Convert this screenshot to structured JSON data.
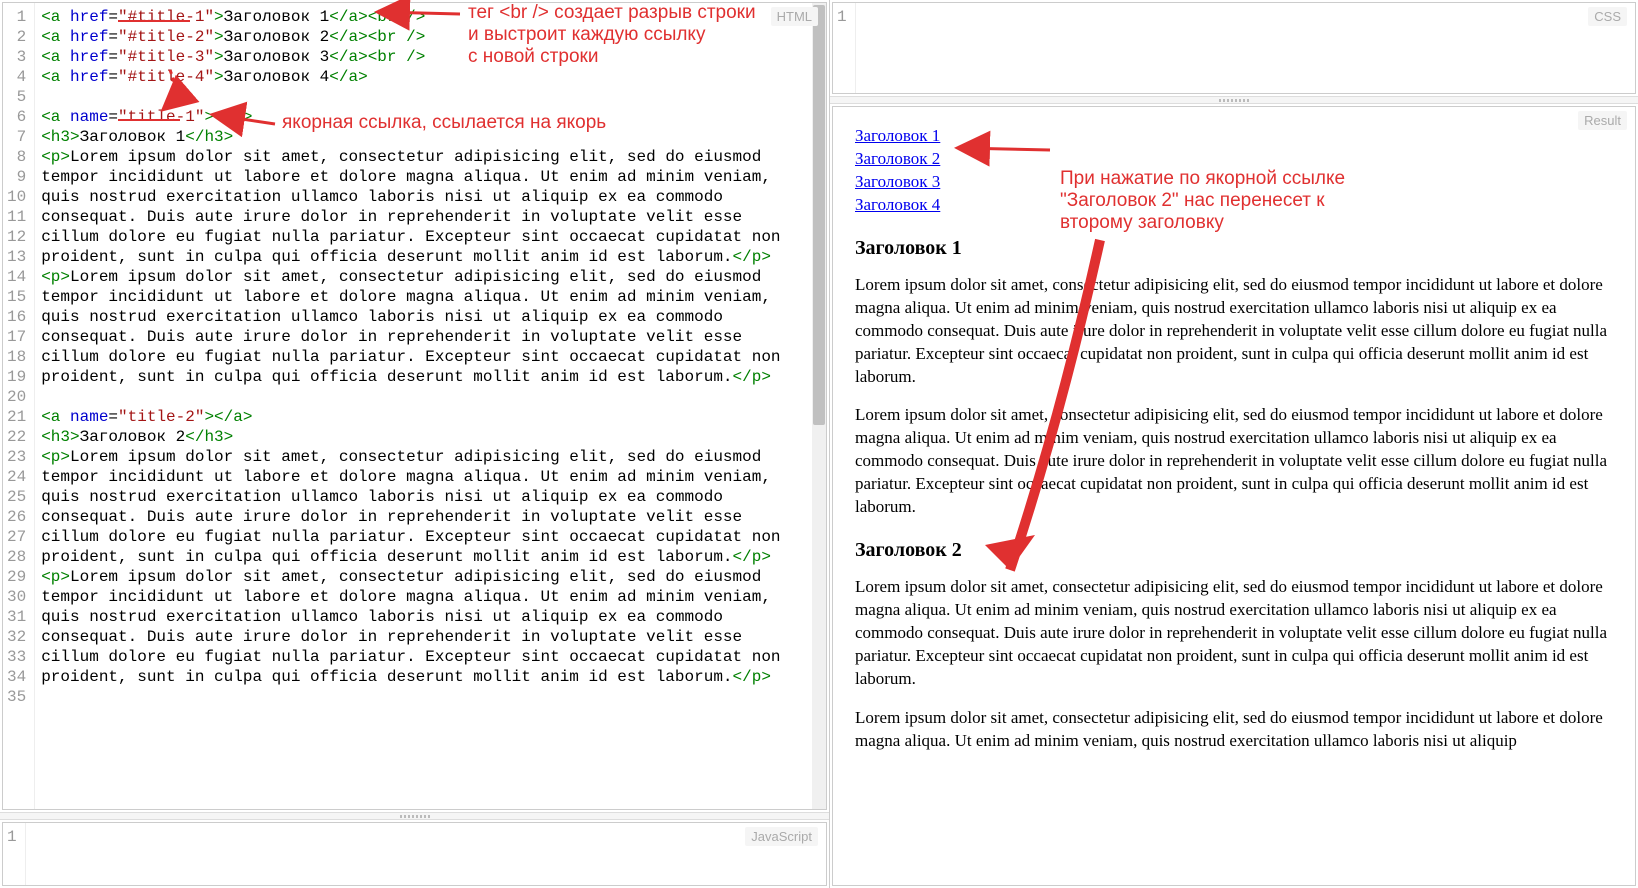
{
  "panels": {
    "html_label": "HTML",
    "css_label": "CSS",
    "js_label": "JavaScript",
    "result_label": "Result"
  },
  "css_panel": {
    "line_numbers": [
      "1"
    ]
  },
  "js_panel": {
    "line_numbers": [
      "1"
    ]
  },
  "html_code": {
    "line_numbers": [
      "1",
      "2",
      "3",
      "4",
      "5",
      "6",
      "7",
      "8",
      "9",
      "10",
      "11",
      "12",
      "13",
      "14",
      "15",
      "16",
      "17",
      "18",
      "19",
      "20",
      "21",
      "22",
      "23",
      "24",
      "25",
      "26",
      "27",
      "28",
      "29",
      "30",
      "31",
      "32",
      "33",
      "34",
      "35"
    ],
    "lines": [
      [
        {
          "c": "tag",
          "t": "<a"
        },
        {
          "c": "txt",
          "t": " "
        },
        {
          "c": "attr",
          "t": "href"
        },
        {
          "c": "txt",
          "t": "="
        },
        {
          "c": "val",
          "t": "\"#title-1\""
        },
        {
          "c": "tag",
          "t": ">"
        },
        {
          "c": "txt",
          "t": "Заголовок 1"
        },
        {
          "c": "tag",
          "t": "</a><br />"
        }
      ],
      [
        {
          "c": "tag",
          "t": "<a"
        },
        {
          "c": "txt",
          "t": " "
        },
        {
          "c": "attr",
          "t": "href"
        },
        {
          "c": "txt",
          "t": "="
        },
        {
          "c": "val",
          "t": "\"#title-2\""
        },
        {
          "c": "tag",
          "t": ">"
        },
        {
          "c": "txt",
          "t": "Заголовок 2"
        },
        {
          "c": "tag",
          "t": "</a><br />"
        }
      ],
      [
        {
          "c": "tag",
          "t": "<a"
        },
        {
          "c": "txt",
          "t": " "
        },
        {
          "c": "attr",
          "t": "href"
        },
        {
          "c": "txt",
          "t": "="
        },
        {
          "c": "val",
          "t": "\"#title-3\""
        },
        {
          "c": "tag",
          "t": ">"
        },
        {
          "c": "txt",
          "t": "Заголовок 3"
        },
        {
          "c": "tag",
          "t": "</a><br />"
        }
      ],
      [
        {
          "c": "tag",
          "t": "<a"
        },
        {
          "c": "txt",
          "t": " "
        },
        {
          "c": "attr",
          "t": "href"
        },
        {
          "c": "txt",
          "t": "="
        },
        {
          "c": "val",
          "t": "\"#title-4\""
        },
        {
          "c": "tag",
          "t": ">"
        },
        {
          "c": "txt",
          "t": "Заголовок 4"
        },
        {
          "c": "tag",
          "t": "</a>"
        }
      ],
      [],
      [
        {
          "c": "tag",
          "t": "<a"
        },
        {
          "c": "txt",
          "t": " "
        },
        {
          "c": "attr",
          "t": "name"
        },
        {
          "c": "txt",
          "t": "="
        },
        {
          "c": "val",
          "t": "\"title-1\""
        },
        {
          "c": "tag",
          "t": "></a>"
        }
      ],
      [
        {
          "c": "tag",
          "t": "<h3>"
        },
        {
          "c": "txt",
          "t": "Заголовок 1"
        },
        {
          "c": "tag",
          "t": "</h3>"
        }
      ],
      [
        {
          "c": "tag",
          "t": "<p>"
        },
        {
          "c": "txt",
          "t": "Lorem ipsum dolor sit amet, consectetur adipisicing elit, sed do eiusmod"
        }
      ],
      [
        {
          "c": "txt",
          "t": "tempor incididunt ut labore et dolore magna aliqua. Ut enim ad minim veniam,"
        }
      ],
      [
        {
          "c": "txt",
          "t": "quis nostrud exercitation ullamco laboris nisi ut aliquip ex ea commodo"
        }
      ],
      [
        {
          "c": "txt",
          "t": "consequat. Duis aute irure dolor in reprehenderit in voluptate velit esse"
        }
      ],
      [
        {
          "c": "txt",
          "t": "cillum dolore eu fugiat nulla pariatur. Excepteur sint occaecat cupidatat non"
        }
      ],
      [
        {
          "c": "txt",
          "t": "proident, sunt in culpa qui officia deserunt mollit anim id est laborum."
        },
        {
          "c": "tag",
          "t": "</p>"
        }
      ],
      [
        {
          "c": "tag",
          "t": "<p>"
        },
        {
          "c": "txt",
          "t": "Lorem ipsum dolor sit amet, consectetur adipisicing elit, sed do eiusmod"
        }
      ],
      [
        {
          "c": "txt",
          "t": "tempor incididunt ut labore et dolore magna aliqua. Ut enim ad minim veniam,"
        }
      ],
      [
        {
          "c": "txt",
          "t": "quis nostrud exercitation ullamco laboris nisi ut aliquip ex ea commodo"
        }
      ],
      [
        {
          "c": "txt",
          "t": "consequat. Duis aute irure dolor in reprehenderit in voluptate velit esse"
        }
      ],
      [
        {
          "c": "txt",
          "t": "cillum dolore eu fugiat nulla pariatur. Excepteur sint occaecat cupidatat non"
        }
      ],
      [
        {
          "c": "txt",
          "t": "proident, sunt in culpa qui officia deserunt mollit anim id est laborum."
        },
        {
          "c": "tag",
          "t": "</p>"
        }
      ],
      [],
      [
        {
          "c": "tag",
          "t": "<a"
        },
        {
          "c": "txt",
          "t": " "
        },
        {
          "c": "attr",
          "t": "name"
        },
        {
          "c": "txt",
          "t": "="
        },
        {
          "c": "val",
          "t": "\"title-2\""
        },
        {
          "c": "tag",
          "t": "></a>"
        }
      ],
      [
        {
          "c": "tag",
          "t": "<h3>"
        },
        {
          "c": "txt",
          "t": "Заголовок 2"
        },
        {
          "c": "tag",
          "t": "</h3>"
        }
      ],
      [
        {
          "c": "tag",
          "t": "<p>"
        },
        {
          "c": "txt",
          "t": "Lorem ipsum dolor sit amet, consectetur adipisicing elit, sed do eiusmod"
        }
      ],
      [
        {
          "c": "txt",
          "t": "tempor incididunt ut labore et dolore magna aliqua. Ut enim ad minim veniam,"
        }
      ],
      [
        {
          "c": "txt",
          "t": "quis nostrud exercitation ullamco laboris nisi ut aliquip ex ea commodo"
        }
      ],
      [
        {
          "c": "txt",
          "t": "consequat. Duis aute irure dolor in reprehenderit in voluptate velit esse"
        }
      ],
      [
        {
          "c": "txt",
          "t": "cillum dolore eu fugiat nulla pariatur. Excepteur sint occaecat cupidatat non"
        }
      ],
      [
        {
          "c": "txt",
          "t": "proident, sunt in culpa qui officia deserunt mollit anim id est laborum."
        },
        {
          "c": "tag",
          "t": "</p>"
        }
      ],
      [
        {
          "c": "tag",
          "t": "<p>"
        },
        {
          "c": "txt",
          "t": "Lorem ipsum dolor sit amet, consectetur adipisicing elit, sed do eiusmod"
        }
      ],
      [
        {
          "c": "txt",
          "t": "tempor incididunt ut labore et dolore magna aliqua. Ut enim ad minim veniam,"
        }
      ],
      [
        {
          "c": "txt",
          "t": "quis nostrud exercitation ullamco laboris nisi ut aliquip ex ea commodo"
        }
      ],
      [
        {
          "c": "txt",
          "t": "consequat. Duis aute irure dolor in reprehenderit in voluptate velit esse"
        }
      ],
      [
        {
          "c": "txt",
          "t": "cillum dolore eu fugiat nulla pariatur. Excepteur sint occaecat cupidatat non"
        }
      ],
      [
        {
          "c": "txt",
          "t": "proident, sunt in culpa qui officia deserunt mollit anim id est laborum."
        },
        {
          "c": "tag",
          "t": "</p>"
        }
      ],
      []
    ]
  },
  "result": {
    "nav": [
      "Заголовок 1",
      "Заголовок 2",
      "Заголовок 3",
      "Заголовок 4"
    ],
    "h1": "Заголовок 1",
    "p1": "Lorem ipsum dolor sit amet, consectetur adipisicing elit, sed do eiusmod tempor incididunt ut labore et dolore magna aliqua. Ut enim ad minim veniam, quis nostrud exercitation ullamco laboris nisi ut aliquip ex ea commodo consequat. Duis aute irure dolor in reprehenderit in voluptate velit esse cillum dolore eu fugiat nulla pariatur. Excepteur sint occaecat cupidatat non proident, sunt in culpa qui officia deserunt mollit anim id est laborum.",
    "p2": "Lorem ipsum dolor sit amet, consectetur adipisicing elit, sed do eiusmod tempor incididunt ut labore et dolore magna aliqua. Ut enim ad minim veniam, quis nostrud exercitation ullamco laboris nisi ut aliquip ex ea commodo consequat. Duis aute irure dolor in reprehenderit in voluptate velit esse cillum dolore eu fugiat nulla pariatur. Excepteur sint occaecat cupidatat non proident, sunt in culpa qui officia deserunt mollit anim id est laborum.",
    "h2": "Заголовок 2",
    "p3": "Lorem ipsum dolor sit amet, consectetur adipisicing elit, sed do eiusmod tempor incididunt ut labore et dolore magna aliqua. Ut enim ad minim veniam, quis nostrud exercitation ullamco laboris nisi ut aliquip ex ea commodo consequat. Duis aute irure dolor in reprehenderit in voluptate velit esse cillum dolore eu fugiat nulla pariatur. Excepteur sint occaecat cupidatat non proident, sunt in culpa qui officia deserunt mollit anim id est laborum.",
    "p4": "Lorem ipsum dolor sit amet, consectetur adipisicing elit, sed do eiusmod tempor incididunt ut labore et dolore magna aliqua. Ut enim ad minim veniam, quis nostrud exercitation ullamco laboris nisi ut aliquip"
  },
  "annotations": {
    "a1_line1": "тег <br /> создает разрыв строки",
    "a1_line2": "и выстроит каждую ссылку",
    "a1_line3": "с новой строки",
    "a2": "якорная ссылка, ссылается на якорь",
    "a3_line1": "При нажатие по якорной ссылке",
    "a3_line2": "\"Заголовок 2\" нас перенесет к",
    "a3_line3": "второму заголовку"
  }
}
